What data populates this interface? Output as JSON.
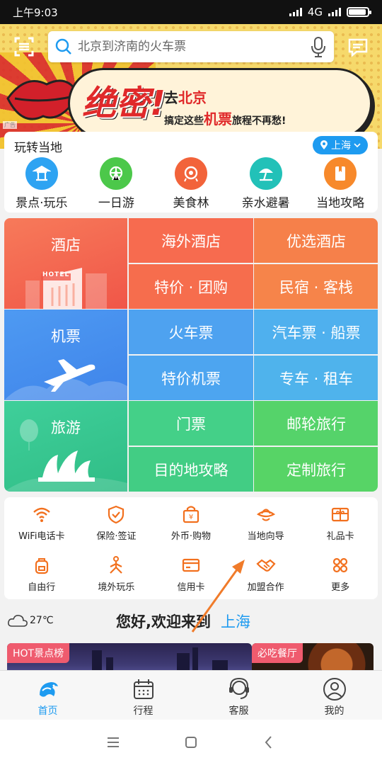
{
  "status": {
    "time": "上午9:03",
    "network": "4G"
  },
  "search": {
    "placeholder": "北京到济南的火车票"
  },
  "banner": {
    "headline": "绝密!",
    "line1_prefix": "去",
    "line1_city": "北京",
    "line2_prefix": "搞定这些",
    "line2_highlight": "机票",
    "line2_suffix": "旅程不再愁!",
    "ad_mark": "广告"
  },
  "local": {
    "title": "玩转当地",
    "city": "上海",
    "items": [
      {
        "label": "景点·玩乐",
        "icon": "pavilion-icon",
        "color": "#2ea3f2"
      },
      {
        "label": "一日游",
        "icon": "ferris-wheel-icon",
        "color": "#4cc84a"
      },
      {
        "label": "美食林",
        "icon": "food-medal-icon",
        "color": "#f2633a"
      },
      {
        "label": "亲水避暑",
        "icon": "beach-umbrella-icon",
        "color": "#22c1b8"
      },
      {
        "label": "当地攻略",
        "icon": "guide-book-icon",
        "color": "#f7892b"
      }
    ]
  },
  "grid": {
    "hotel": {
      "main": "酒店",
      "cells": [
        "海外酒店",
        "优选酒店",
        "特价 · 团购",
        "民宿 · 客栈"
      ],
      "sign": "HOTEL"
    },
    "flight": {
      "main": "机票",
      "cells": [
        "火车票",
        "汽车票 · 船票",
        "特价机票",
        "专车 · 租车"
      ]
    },
    "travel": {
      "main": "旅游",
      "cells": [
        "门票",
        "邮轮旅行",
        "目的地攻略",
        "定制旅行"
      ]
    }
  },
  "services": {
    "row1": [
      {
        "label": "WiFi电话卡",
        "icon": "wifi-icon"
      },
      {
        "label": "保险·签证",
        "icon": "shield-icon"
      },
      {
        "label": "外币·购物",
        "icon": "shopping-bag-icon"
      },
      {
        "label": "当地向导",
        "icon": "guide-hat-icon"
      },
      {
        "label": "礼品卡",
        "icon": "gift-card-icon"
      }
    ],
    "row2": [
      {
        "label": "自由行",
        "icon": "backpack-icon"
      },
      {
        "label": "境外玩乐",
        "icon": "yoga-icon"
      },
      {
        "label": "信用卡",
        "icon": "credit-card-icon"
      },
      {
        "label": "加盟合作",
        "icon": "handshake-icon"
      },
      {
        "label": "更多",
        "icon": "more-grid-icon"
      }
    ],
    "accent": "#f2701e"
  },
  "welcome": {
    "temperature": "27℃",
    "text": "您好,欢迎来到",
    "city": "上海"
  },
  "cards": {
    "hot": "HOT景点榜",
    "food": "必吃餐厅"
  },
  "tabs": [
    {
      "label": "首页",
      "icon": "dolphin-home-icon",
      "active": true
    },
    {
      "label": "行程",
      "icon": "calendar-icon",
      "active": false
    },
    {
      "label": "客服",
      "icon": "headset-icon",
      "active": false
    },
    {
      "label": "我的",
      "icon": "user-icon",
      "active": false
    }
  ],
  "colors": {
    "primary": "#1e9bf0",
    "hotel": "#f26a4f",
    "flight": "#4a9ff0",
    "travel": "#3ec88a"
  }
}
